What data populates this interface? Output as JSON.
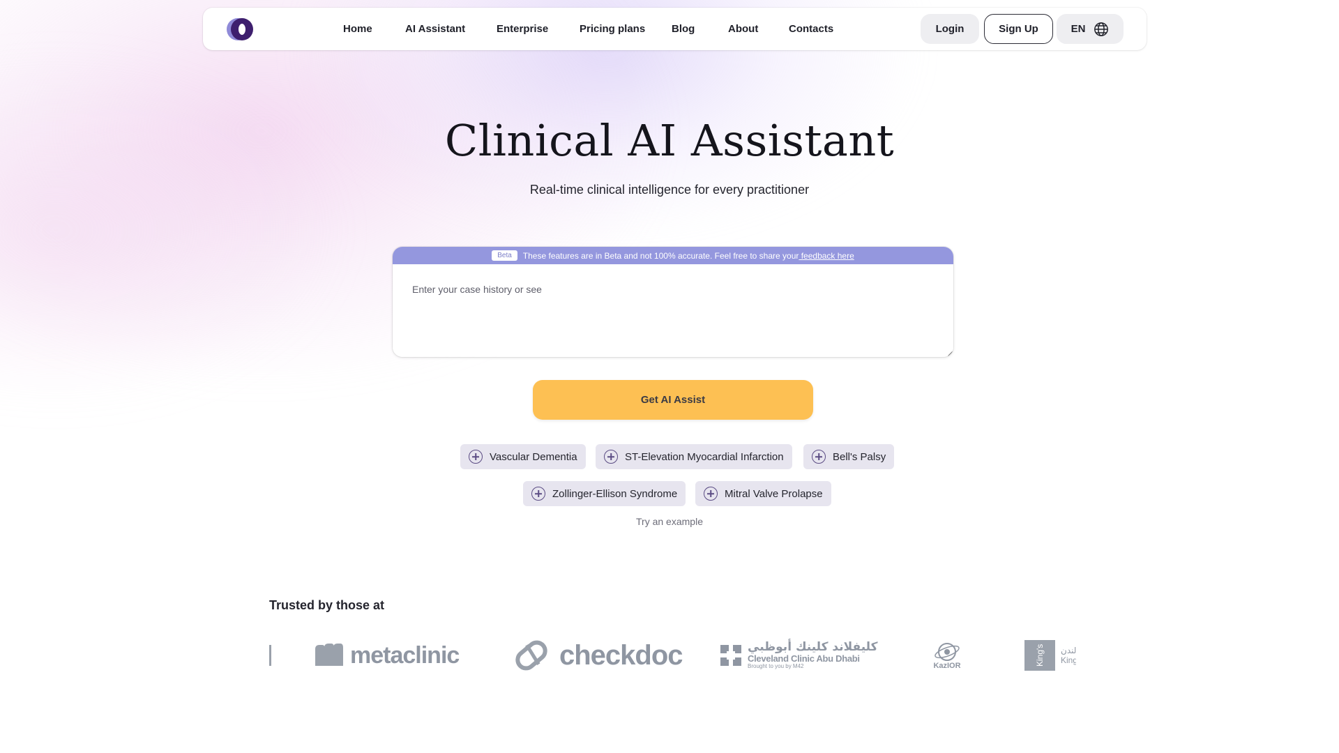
{
  "nav": {
    "links": [
      "Home",
      "AI Assistant",
      "Enterprise",
      "Pricing plans",
      "Blog",
      "About",
      "Contacts"
    ],
    "login_label": "Login",
    "signup_label": "Sign Up",
    "language": "EN"
  },
  "hero": {
    "title": "Clinical AI Assistant",
    "subtitle": "Real-time clinical intelligence for every practitioner"
  },
  "input_card": {
    "beta_badge": "Beta",
    "beta_notice": "These features are in Beta and not 100% accurate. Feel free to share your",
    "beta_link": " feedback here",
    "placeholder": "Enter your case history or see",
    "value": ""
  },
  "cta": {
    "label": "Get AI Assist"
  },
  "examples": {
    "items": [
      "Vascular Dementia",
      "ST-Elevation Myocardial Infarction",
      "Bell's Palsy",
      "Zollinger-Ellison Syndrome",
      "Mitral Valve Prolapse"
    ],
    "caption": "Try an example"
  },
  "trusted": {
    "title": "Trusted by those at",
    "logos": {
      "metaclinic": "metaclinic",
      "checkdoc": "checkdoc",
      "cleveland_ar": "كليفلاند كلينك أبوظبي",
      "cleveland_en": "Cleveland Clinic Abu Dhabi",
      "cleveland_sub": "Brought to you by M42",
      "kazior": "KazIOR",
      "kings_box": "King's",
      "kings_ar": "لندن",
      "kings_en": "King"
    }
  },
  "colors": {
    "accent_yellow": "#fdc053",
    "beta_bar": "#9497de",
    "chip_bg": "#e7e5ef",
    "logo_purple": "#4a2a7a"
  }
}
